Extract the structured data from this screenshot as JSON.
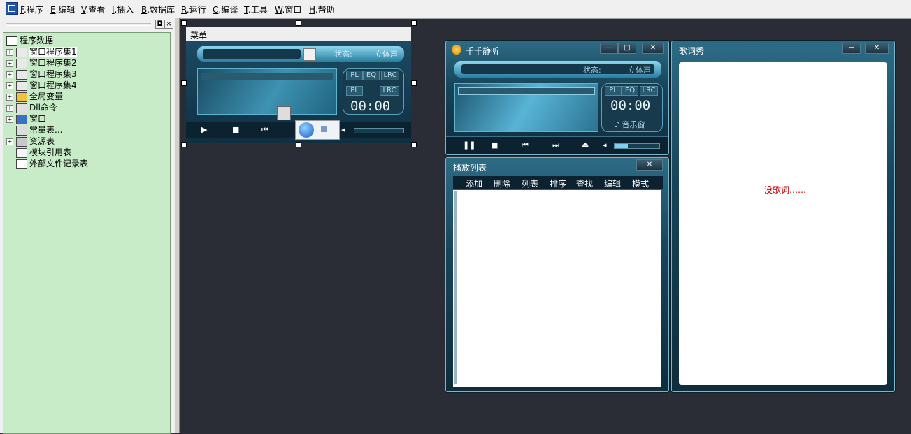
{
  "menubar": {
    "items": [
      {
        "key": "F",
        "label": ".程序"
      },
      {
        "key": "E",
        "label": ".编辑"
      },
      {
        "key": "V",
        "label": ".查看"
      },
      {
        "key": "I",
        "label": ".插入"
      },
      {
        "key": "B",
        "label": ".数据库"
      },
      {
        "key": "R",
        "label": ".运行"
      },
      {
        "key": "C",
        "label": ".编译"
      },
      {
        "key": "T",
        "label": ".工具"
      },
      {
        "key": "W",
        "label": ".窗口"
      },
      {
        "key": "H",
        "label": ".帮助"
      }
    ]
  },
  "panel": {
    "float_label": "◘",
    "close_label": "×"
  },
  "tree": {
    "root": "程序数据",
    "items": [
      {
        "label": "窗口程序集1",
        "icon": "assembly-icon",
        "expand": "+"
      },
      {
        "label": "窗口程序集2",
        "icon": "assembly-icon",
        "expand": "+"
      },
      {
        "label": "窗口程序集3",
        "icon": "assembly-icon",
        "expand": "+"
      },
      {
        "label": "窗口程序集4",
        "icon": "assembly-icon",
        "expand": "+"
      },
      {
        "label": "全局变量",
        "icon": "globals-icon",
        "expand": "+"
      },
      {
        "label": "Dll命令",
        "icon": "dll-icon",
        "expand": "+"
      },
      {
        "label": "窗口",
        "icon": "window-icon",
        "expand": "+"
      },
      {
        "label": "常量表...",
        "icon": "constants-icon",
        "expand": ""
      },
      {
        "label": "资源表",
        "icon": "resources-icon",
        "expand": "+"
      },
      {
        "label": "模块引用表",
        "icon": "module-icon",
        "expand": ""
      },
      {
        "label": "外部文件记录表",
        "icon": "file-icon",
        "expand": ""
      }
    ]
  },
  "design_form": {
    "title": "菜单",
    "status_label": "状态:",
    "status_value": "立体声",
    "tabs": [
      "PL",
      "EQ",
      "LRC"
    ],
    "tab2": [
      "PL",
      "LRC"
    ],
    "time": "00:00"
  },
  "player": {
    "title": "千千静听",
    "status_label": "状态:",
    "status_value": "立体声",
    "tabs": [
      "PL",
      "EQ",
      "LRC"
    ],
    "time": "00:00",
    "music_window": "♪ 音乐窗",
    "buttons": {
      "min": "—",
      "max": "□",
      "close": "✕"
    }
  },
  "playlist": {
    "title": "播放列表",
    "close": "✕",
    "menu": [
      "添加",
      "删除",
      "列表",
      "排序",
      "查找",
      "编辑",
      "模式"
    ]
  },
  "lyrics": {
    "title": "歌词秀",
    "pin": "⊣",
    "close": "✕",
    "empty_text": "没歌词……",
    "empty_color": "#c00000"
  }
}
